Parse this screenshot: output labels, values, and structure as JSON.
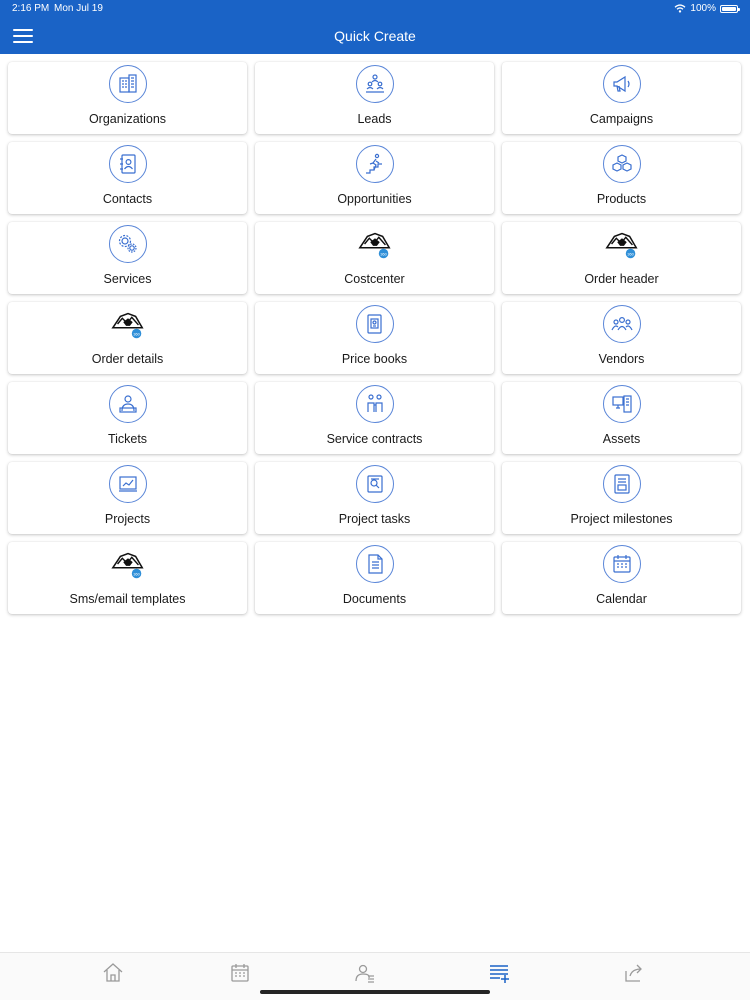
{
  "status_bar": {
    "time": "2:16 PM",
    "date": "Mon Jul 19",
    "battery": "100%"
  },
  "header": {
    "title": "Quick Create"
  },
  "items": [
    {
      "label": "Organizations",
      "icon": "organizations-icon"
    },
    {
      "label": "Leads",
      "icon": "leads-icon"
    },
    {
      "label": "Campaigns",
      "icon": "campaigns-icon"
    },
    {
      "label": "Contacts",
      "icon": "contacts-icon"
    },
    {
      "label": "Opportunities",
      "icon": "opportunities-icon"
    },
    {
      "label": "Products",
      "icon": "products-icon"
    },
    {
      "label": "Services",
      "icon": "services-icon"
    },
    {
      "label": "Costcenter",
      "icon": "custom-module-icon"
    },
    {
      "label": "Order header",
      "icon": "custom-module-icon"
    },
    {
      "label": "Order details",
      "icon": "custom-module-icon"
    },
    {
      "label": "Price books",
      "icon": "price-books-icon"
    },
    {
      "label": "Vendors",
      "icon": "vendors-icon"
    },
    {
      "label": "Tickets",
      "icon": "tickets-icon"
    },
    {
      "label": "Service contracts",
      "icon": "service-contracts-icon"
    },
    {
      "label": "Assets",
      "icon": "assets-icon"
    },
    {
      "label": "Projects",
      "icon": "projects-icon"
    },
    {
      "label": "Project tasks",
      "icon": "project-tasks-icon"
    },
    {
      "label": "Project milestones",
      "icon": "project-milestones-icon"
    },
    {
      "label": "Sms/email templates",
      "icon": "custom-module-icon"
    },
    {
      "label": "Documents",
      "icon": "documents-icon"
    },
    {
      "label": "Calendar",
      "icon": "calendar-icon"
    }
  ],
  "tabbar": {
    "tabs": [
      {
        "name": "home",
        "icon": "home-icon"
      },
      {
        "name": "calendar",
        "icon": "calendar-tab-icon"
      },
      {
        "name": "contacts",
        "icon": "contacts-tab-icon"
      },
      {
        "name": "quick-create",
        "icon": "quick-create-icon",
        "active": true
      },
      {
        "name": "share",
        "icon": "share-icon"
      }
    ]
  },
  "colors": {
    "header": "#1a63c6",
    "icon_stroke": "#3a6fd0",
    "tab_inactive": "#9a9a9a",
    "tab_active": "#1a63c6"
  }
}
